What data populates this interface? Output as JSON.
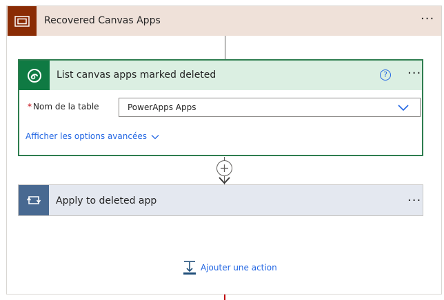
{
  "scope": {
    "title": "Recovered Canvas Apps",
    "icon": "scope-icon",
    "more": "···"
  },
  "list_action": {
    "title": "List canvas apps marked deleted",
    "icon": "dataverse-icon",
    "help": "?",
    "more": "···",
    "table_label": "Nom de la table",
    "table_required_mark": "*",
    "table_value": "PowerApps Apps",
    "advanced_options": "Afficher les options avancées"
  },
  "apply_action": {
    "title": "Apply to deleted app",
    "icon": "loop-icon",
    "more": "···"
  },
  "add_action": {
    "label": "Ajouter une action"
  },
  "colors": {
    "scope_accent": "#8a2c05",
    "dataverse_accent": "#0f7a43",
    "apply_accent": "#486991",
    "link": "#2266e3"
  }
}
